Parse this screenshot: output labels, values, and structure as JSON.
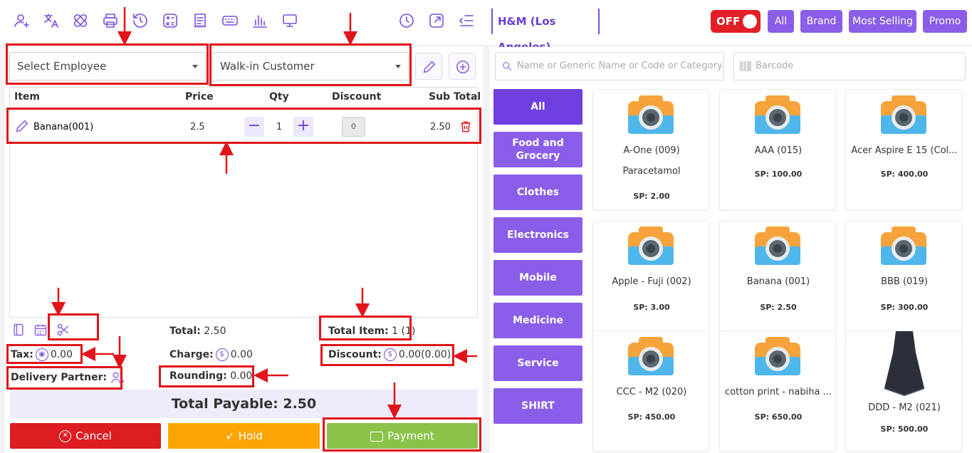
{
  "topbar": {
    "icons": [
      "user-icon",
      "translate-icon",
      "bandage-icon",
      "printer-icon",
      "history-icon",
      "calculator-icon",
      "receipt-icon",
      "keyboard-icon",
      "chart-icon",
      "monitor-icon",
      "clock-icon",
      "external-link-icon",
      "collapse-icon"
    ],
    "store_name": "H&M (Los Angeles)",
    "toggle_label": "OFF",
    "filters": [
      "All",
      "Brand",
      "Most Selling",
      "Promo"
    ]
  },
  "selects": {
    "employee": "Select Employee",
    "customer": "Walk-in Customer"
  },
  "cart": {
    "headers": {
      "item": "Item",
      "price": "Price",
      "qty": "Qty",
      "discount": "Discount",
      "subtotal": "Sub Total"
    },
    "row": {
      "name": "Banana(001)",
      "price": "2.5",
      "qty": "1",
      "discount": "0",
      "subtotal": "2.50"
    }
  },
  "summary": {
    "total_label": "Total:",
    "total_value": "2.50",
    "total_item_label": "Total Item:",
    "total_item_value": "1 (1)",
    "tax_label": "Tax:",
    "tax_value": "0.00",
    "charge_label": "Charge:",
    "charge_value": "0.00",
    "discount_label": "Discount:",
    "discount_value": "0.00(0.00)",
    "delivery_label": "Delivery Partner:",
    "rounding_label": "Rounding:",
    "rounding_value": "0.00",
    "payable": "Total Payable: 2.50"
  },
  "actions": {
    "cancel": "Cancel",
    "hold": "Hold",
    "payment": "Payment"
  },
  "search": {
    "product_placeholder": "Name or Generic Name or Code or Category",
    "barcode_placeholder": "Barcode"
  },
  "categories": [
    "All",
    "Food and Grocery",
    "Clothes",
    "Electronics",
    "Mobile",
    "Medicine",
    "Service",
    "SHIRT"
  ],
  "products": [
    {
      "name": "A-One (009)",
      "generic": "Paracetamol",
      "price": "SP: 2.00"
    },
    {
      "name": "AAA (015)",
      "generic": "",
      "price": "SP: 100.00"
    },
    {
      "name": "Acer Aspire E 15 (Col...",
      "generic": "",
      "price": "SP: 400.00"
    },
    {
      "name": "Apple - Fuji (002)",
      "generic": "",
      "price": "SP: 3.00"
    },
    {
      "name": "Banana (001)",
      "generic": "",
      "price": "SP: 2.50"
    },
    {
      "name": "BBB (019)",
      "generic": "",
      "price": "SP: 300.00"
    },
    {
      "name": "CCC - M2 (020)",
      "generic": "",
      "price": "SP: 450.00"
    },
    {
      "name": "cotton print - nabiha ...",
      "generic": "",
      "price": "SP: 650.00"
    },
    {
      "name": "DDD - M2 (021)",
      "generic": "",
      "price": "SP: 500.00"
    }
  ],
  "colors": {
    "accent": "#8a5ee8",
    "annotation": "#e0141a",
    "cancel": "#dc1d22",
    "hold": "#fca504",
    "payment": "#8bc34a"
  }
}
